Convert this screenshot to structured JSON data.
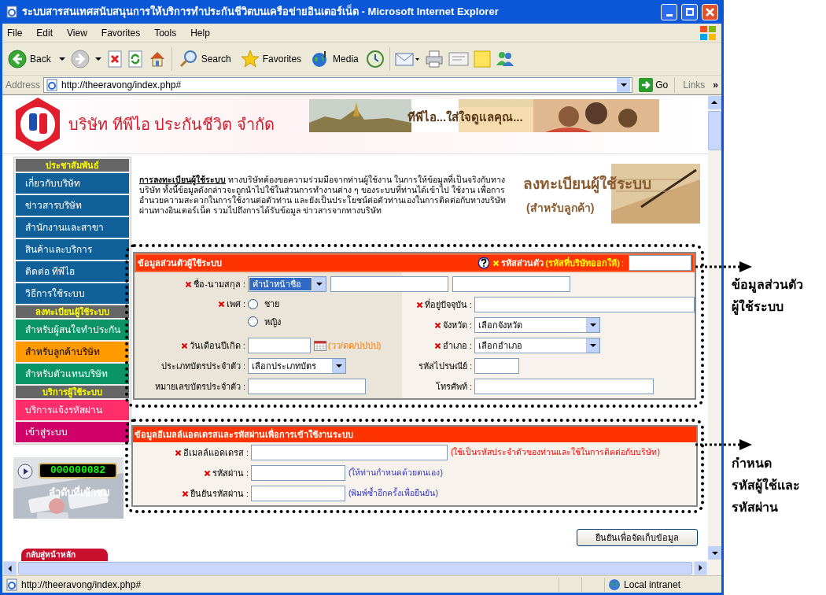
{
  "window": {
    "title": "ระบบสารสนเทศสนับสนุนการให้บริการทำประกันชีวิตบนเครือข่ายอินเตอร์เน็ต - Microsoft Internet Explorer"
  },
  "menu": [
    "File",
    "Edit",
    "View",
    "Favorites",
    "Tools",
    "Help"
  ],
  "toolbar": [
    "Back",
    "Search",
    "Favorites",
    "Media"
  ],
  "address_bar": {
    "label": "Address",
    "url": "http://theeravong/index.php#",
    "go": "Go",
    "links": "Links",
    "more": "»"
  },
  "header": {
    "company": "บริษัท ทีพีไอ ประกันชีวิต จำกัด",
    "slogan": "ทีพีไอ...ใส่ใจดูแลคุณ..."
  },
  "sidebar": [
    {
      "heading": "ประชาสัมพันธ์",
      "items": [
        {
          "label": "เกี่ยวกับบริษัท",
          "color": "#10609a",
          "selected": false
        },
        {
          "label": "ข่าวสารบริษัท",
          "color": "#10609a",
          "selected": false
        },
        {
          "label": "สำนักงานและสาขา",
          "color": "#10609a",
          "selected": false
        },
        {
          "label": "สินค้าและบริการ",
          "color": "#10609a",
          "selected": false
        },
        {
          "label": "ติดต่อ ทีพีไอ",
          "color": "#10609a",
          "selected": false
        },
        {
          "label": "วิธีการใช้ระบบ",
          "color": "#10609a",
          "selected": false
        }
      ]
    },
    {
      "heading": "ลงทะเบียนผู้ใช้ระบบ",
      "items": [
        {
          "label": "สำหรับผู้สนใจทำประกัน",
          "color": "#0b9466",
          "selected": false
        },
        {
          "label": "สำหรับลูกค้าบริษัท",
          "color": "#ff9a00",
          "selected": true
        },
        {
          "label": "สำหรับตัวแทนบริษัท",
          "color": "#0b9466",
          "selected": false
        }
      ]
    },
    {
      "heading": "บริการผู้ใช้ระบบ",
      "items": [
        {
          "label": "บริการแจ้งรหัสผ่าน",
          "color": "#ff2d6a",
          "selected": false
        },
        {
          "label": "เข้าสู่ระบบ",
          "color": "#d00068",
          "selected": false
        }
      ]
    }
  ],
  "counter": {
    "value": "000000082",
    "caption": "ลำดับที่เข้าชม"
  },
  "home_button": "กลับสู่หน้าหลัก",
  "intro": {
    "text": "**การลงทะเบียนผู้ใช้ระบบ** ทางบริษัทต้องขอความร่วมมือจากท่านผู้ใช้งาน ในการให้ข้อมูลที่เป็นจริงกับทางบริษัท   ทั้งนี้ข้อมูลดังกล่าวจะถูกนำไปใช้ในส่วนการทำงานต่าง ๆ ของระบบที่ท่านได้เข้าไป ใช้งาน เพื่อการอำนวยความสะดวกในการใช้งานต่อตัวท่าน และยังเป็นประโยชน์ต่อตัวท่านเองในการติดต่อกับทางบริษัท ผ่านทางอินเตอร์เน็ต รวมไปถึงการได้รับข้อมูล ข่าวสารจากทางบริษัท",
    "banner_title": "ลงทะเบียนผู้ใช้ระบบ",
    "banner_subtitle": "(สำหรับลูกค้า)"
  },
  "personal_form": {
    "title": "ข้อมูลส่วนตัวผู้ใช้ระบบ",
    "id_field": {
      "label": "รหัสส่วนตัว",
      "hint": "(รหัสที่บริษัทออกให้)",
      "suffix": ":",
      "required": true
    },
    "name_field": {
      "label": "ชื่อ-นามสกุล :",
      "required": true,
      "value": "คำนำหน้าชื่อ"
    },
    "left": [
      {
        "kind": "radio",
        "label": "เพศ :",
        "required": true,
        "options": [
          {
            "label": "ชาย",
            "checked": false
          },
          {
            "label": "หญิง",
            "checked": false
          }
        ]
      },
      {
        "kind": "date",
        "label": "วันเดือนปีเกิด :",
        "required": true,
        "hint": "(วว/ดด/ปปปป)"
      },
      {
        "kind": "select",
        "label": "ประเภทบัตรประจำตัว :",
        "required": false,
        "value": "เลือกประเภทบัตร"
      },
      {
        "kind": "text",
        "label": "หมายเลขบัตรประจำตัว :",
        "required": false
      }
    ],
    "right": [
      {
        "kind": "text",
        "label": "ที่อยู่ปัจจุบัน :",
        "required": true
      },
      {
        "kind": "select",
        "label": "จังหวัด :",
        "required": true,
        "value": "เลือกจังหวัด"
      },
      {
        "kind": "select",
        "label": "อำเภอ :",
        "required": true,
        "value": "เลือกอำเภอ"
      },
      {
        "kind": "text",
        "label": "รหัสไปรษณีย์ :",
        "required": false
      },
      {
        "kind": "text",
        "label": "โทรศัพท์ :",
        "required": false
      }
    ]
  },
  "account_form": {
    "title": "ข้อมูลอีเมลล์แอดเดรสและรหัสผ่านเพื่อการเข้าใช้งานระบบ",
    "fields": [
      {
        "label": "อีเมลล์แอดเดรส :",
        "required": true,
        "hint": "(ใช้เป็นรหัสประจำตัวของท่านและใช้ในการติดต่อกับบริษัท)",
        "color": "#ff0000"
      },
      {
        "label": "รหัสผ่าน :",
        "required": true,
        "hint": "(ให้ท่านกำหนดด้วยตนเอง)",
        "color": "#3333cc"
      },
      {
        "label": "ยืนยันรหัสผ่าน :",
        "required": true,
        "hint": "(พิมพ์ซ้ำอีกครั้งเพื่อยืนยัน)",
        "color": "#3333cc"
      }
    ]
  },
  "submit": "ยืนยันเพื่อจัดเก็บข้อมูล",
  "annotations": [
    "ข้อมูลส่วนตัว\nผู้ใช้ระบบ",
    "กำหนด\nรหัสผู้ใช้และ\nรหัสผ่าน"
  ],
  "status_bar": {
    "url": "http://theeravong/index.php#",
    "zone": "Local intranet"
  }
}
